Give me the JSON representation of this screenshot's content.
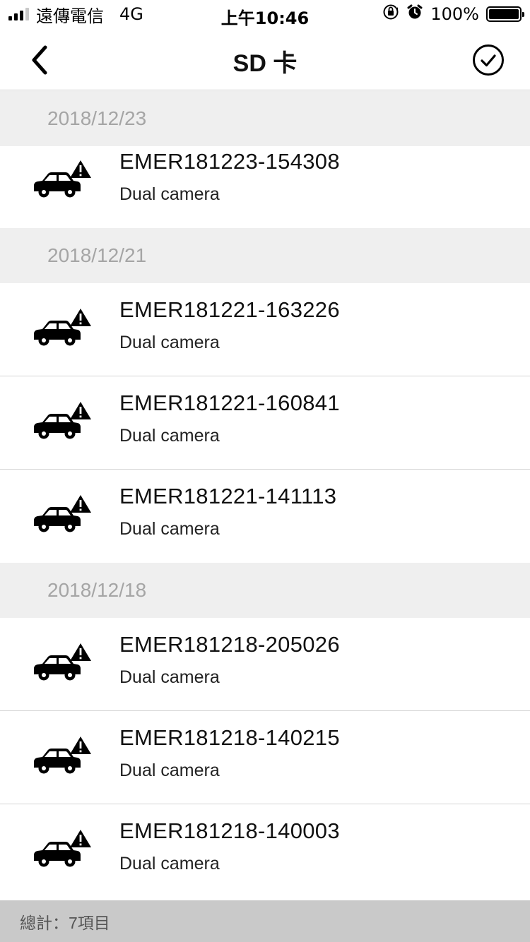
{
  "status_bar": {
    "carrier": "遠傳電信",
    "network": "4G",
    "time": "上午10:46",
    "battery_text": "100%",
    "battery_level": 1.0,
    "signal_bars": 3,
    "icons": [
      "orientation-lock-icon",
      "alarm-icon",
      "battery-icon"
    ]
  },
  "nav": {
    "title": "SD 卡",
    "back_icon": "chevron-left-icon",
    "confirm_icon": "check-circle-icon"
  },
  "sections": [
    {
      "date": "2018/12/23",
      "items": [
        {
          "name": "EMER181223-154308",
          "subtitle": "Dual camera",
          "icon": "car-warning-icon"
        }
      ]
    },
    {
      "date": "2018/12/21",
      "items": [
        {
          "name": "EMER181221-163226",
          "subtitle": "Dual camera",
          "icon": "car-warning-icon"
        },
        {
          "name": "EMER181221-160841",
          "subtitle": "Dual camera",
          "icon": "car-warning-icon"
        },
        {
          "name": "EMER181221-141113",
          "subtitle": "Dual camera",
          "icon": "car-warning-icon"
        }
      ]
    },
    {
      "date": "2018/12/18",
      "items": [
        {
          "name": "EMER181218-205026",
          "subtitle": "Dual camera",
          "icon": "car-warning-icon"
        },
        {
          "name": "EMER181218-140215",
          "subtitle": "Dual camera",
          "icon": "car-warning-icon"
        },
        {
          "name": "EMER181218-140003",
          "subtitle": "Dual camera",
          "icon": "car-warning-icon"
        }
      ]
    }
  ],
  "footer": {
    "total_text": "總計：7項目"
  },
  "colors": {
    "section_bg": "#efefef",
    "section_text": "#a5a5a5",
    "footer_bg": "#c9c9c9",
    "divider": "#d4d4d4"
  }
}
